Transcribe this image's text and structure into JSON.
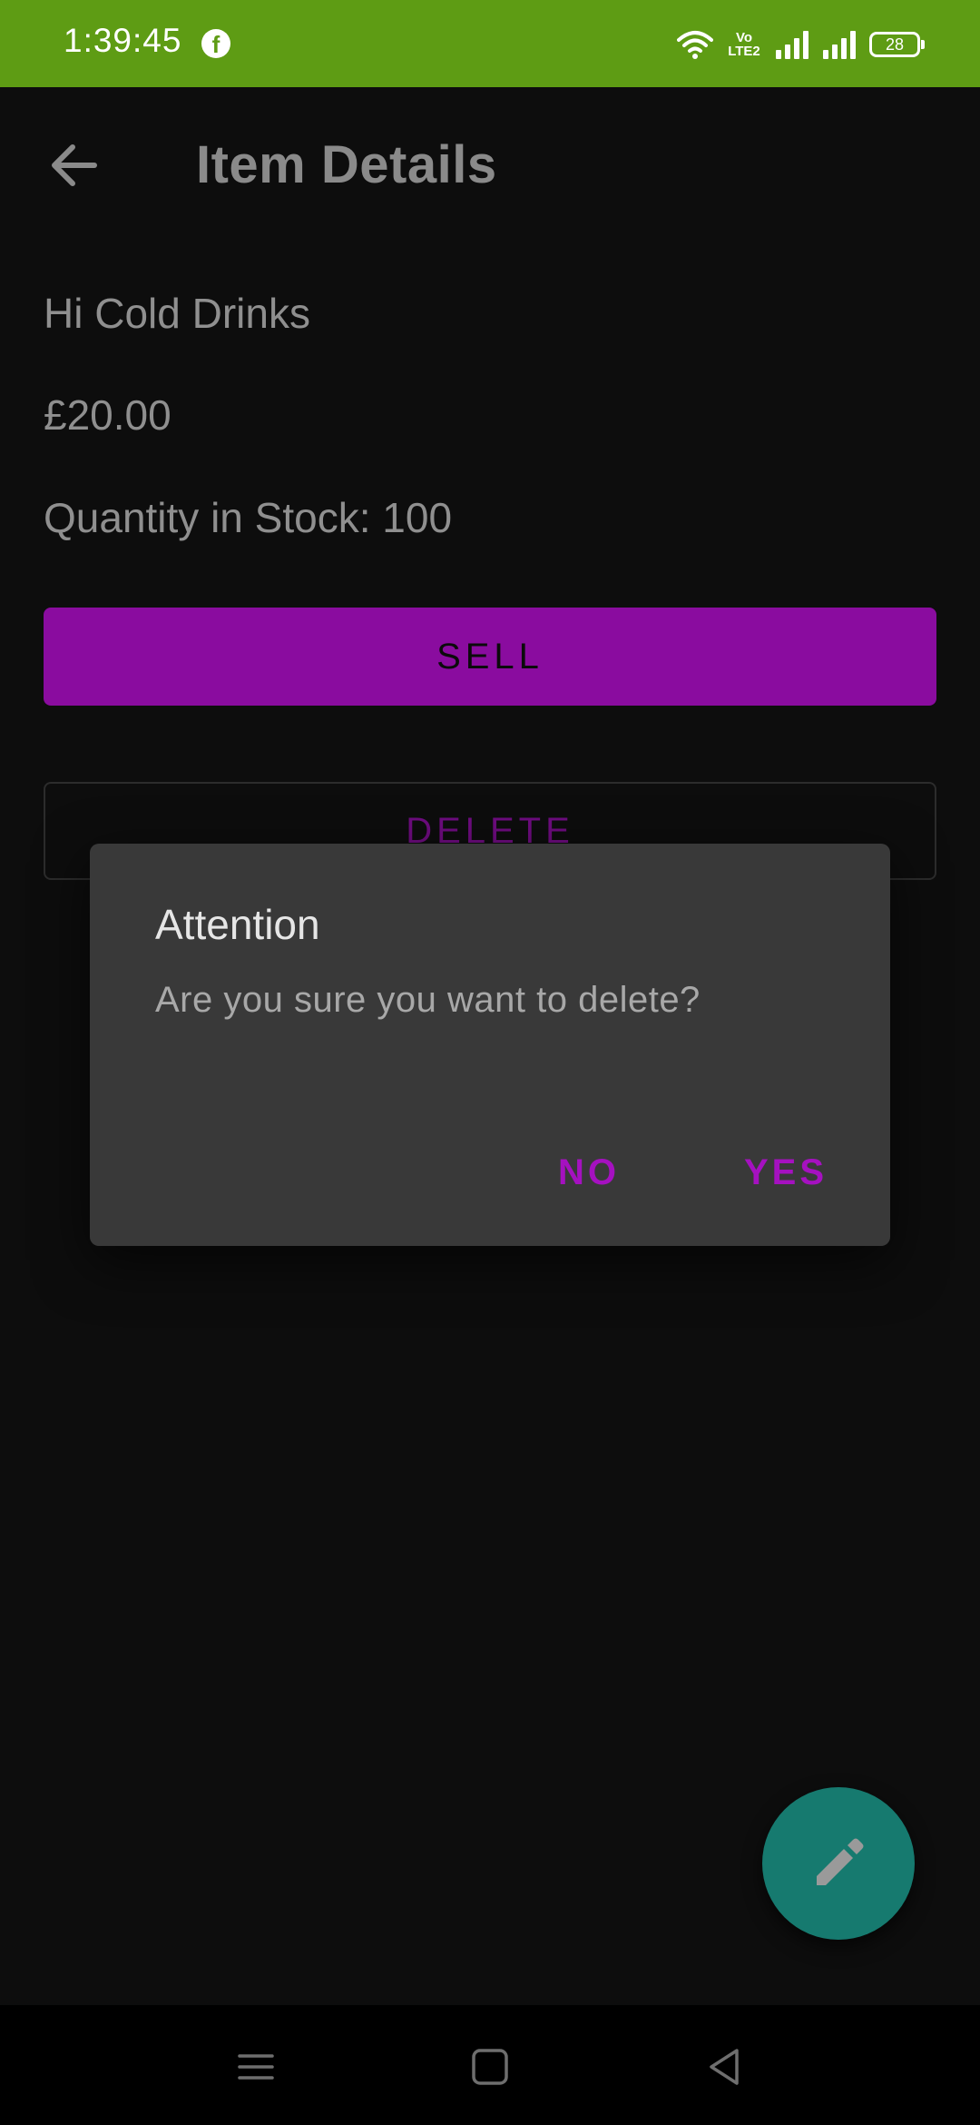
{
  "status_bar": {
    "time": "1:39:45",
    "volte_line1": "Vo",
    "volte_line2": "LTE2",
    "battery": "28",
    "icons": [
      "facebook-icon",
      "wifi-icon",
      "volte-icon",
      "signal-icon",
      "signal-icon",
      "battery-icon"
    ],
    "background": "#5e9c14"
  },
  "app_bar": {
    "title": "Item Details",
    "back_icon": "arrow-back-icon"
  },
  "item": {
    "name": "Hi Cold Drinks",
    "price": "£20.00",
    "quantity_text": "Quantity in Stock:  100"
  },
  "actions": {
    "sell_label": "SELL",
    "delete_label": "DELETE",
    "accent_color": "#8a0c9f"
  },
  "dialog": {
    "title": "Attention",
    "message": "Are you sure you want to delete?",
    "no_label": "NO",
    "yes_label": "YES"
  },
  "fab": {
    "icon": "pencil-edit-icon",
    "color": "#167a6f"
  },
  "nav_bar": {
    "icons": [
      "menu-icon",
      "home-square-icon",
      "back-triangle-icon"
    ]
  }
}
